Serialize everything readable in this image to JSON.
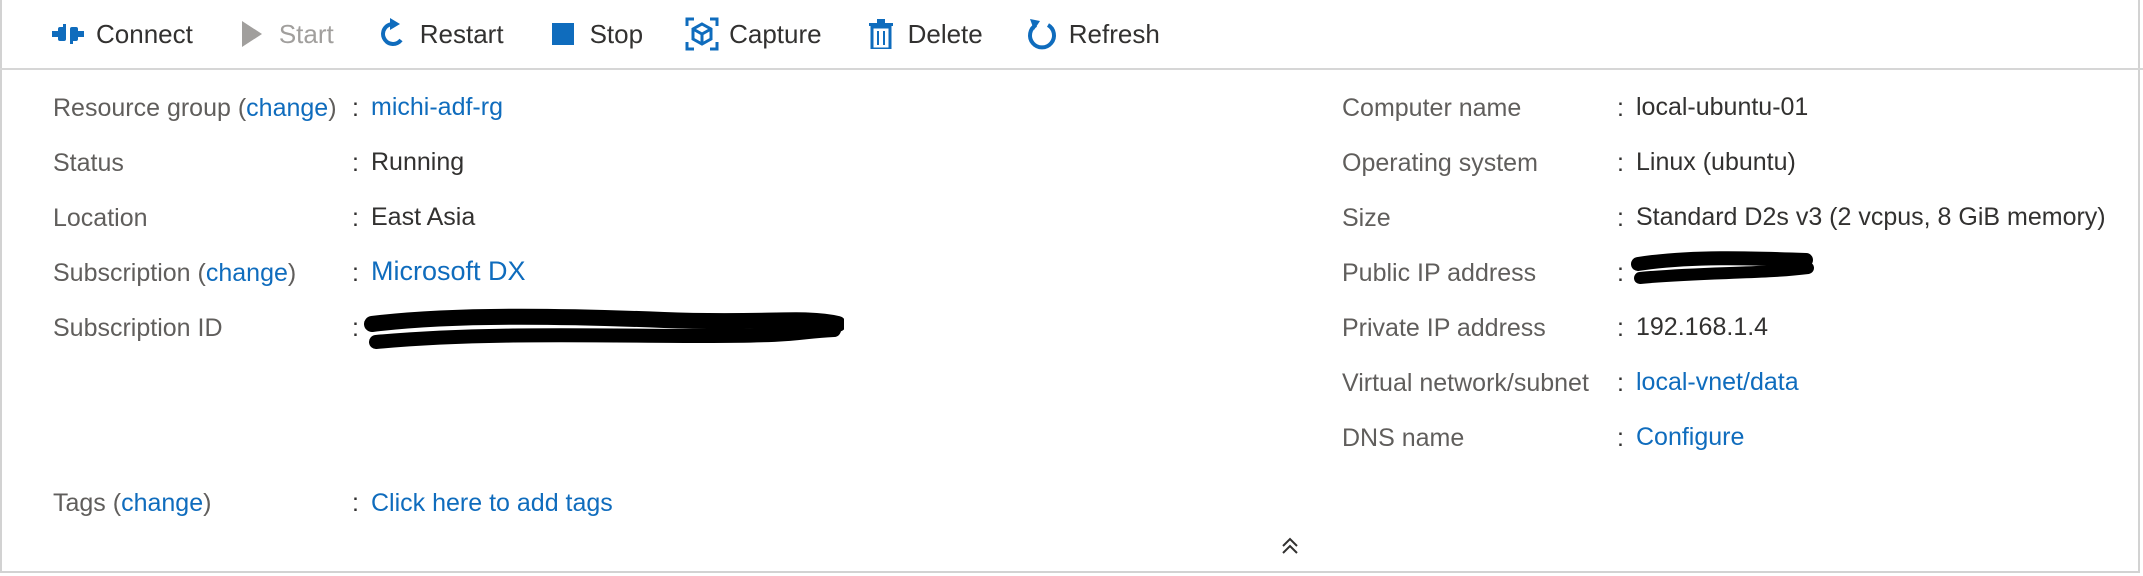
{
  "toolbar": {
    "items": [
      {
        "label": "Connect",
        "icon": "connect-icon",
        "enabled": true
      },
      {
        "label": "Start",
        "icon": "play-icon",
        "enabled": false
      },
      {
        "label": "Restart",
        "icon": "restart-icon",
        "enabled": true
      },
      {
        "label": "Stop",
        "icon": "stop-icon",
        "enabled": true
      },
      {
        "label": "Capture",
        "icon": "capture-icon",
        "enabled": true
      },
      {
        "label": "Delete",
        "icon": "trash-icon",
        "enabled": true
      },
      {
        "label": "Refresh",
        "icon": "refresh-icon",
        "enabled": true
      }
    ]
  },
  "essentials": {
    "left": {
      "resource_group": {
        "label": "Resource group",
        "change": "change",
        "value": "michi-adf-rg"
      },
      "status": {
        "label": "Status",
        "value": "Running"
      },
      "location": {
        "label": "Location",
        "value": "East Asia"
      },
      "subscription": {
        "label": "Subscription",
        "change": "change",
        "value": "Microsoft DX"
      },
      "subscription_id": {
        "label": "Subscription ID",
        "value": "[redacted]"
      },
      "tags": {
        "label": "Tags",
        "change": "change",
        "value": "Click here to add tags"
      }
    },
    "right": {
      "computer_name": {
        "label": "Computer name",
        "value": "local-ubuntu-01"
      },
      "operating_system": {
        "label": "Operating system",
        "value": "Linux (ubuntu)"
      },
      "size": {
        "label": "Size",
        "value": "Standard D2s v3 (2 vcpus, 8 GiB memory)"
      },
      "public_ip": {
        "label": "Public IP address",
        "value": "[redacted]"
      },
      "private_ip": {
        "label": "Private IP address",
        "value": "192.168.1.4"
      },
      "vnet_subnet": {
        "label": "Virtual network/subnet",
        "value": "local-vnet/data"
      },
      "dns_name": {
        "label": "DNS name",
        "value": "Configure"
      }
    },
    "separator": ":"
  },
  "colors": {
    "link": "#0f6cbd",
    "label": "#605e5c",
    "text": "#323130",
    "icon_blue": "#0f6cbd",
    "disabled": "#a19f9d"
  },
  "collapse_icon": "double-chevron-up-icon"
}
